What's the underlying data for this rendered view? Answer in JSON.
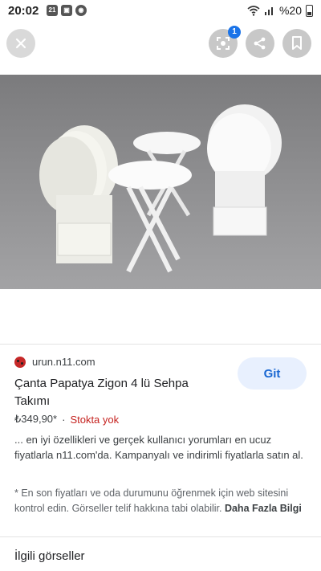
{
  "status_bar": {
    "time": "20:02",
    "battery": "%20",
    "notif_icons": [
      "21",
      "▣",
      "◉"
    ]
  },
  "toolbar": {
    "lens_badge": "1"
  },
  "result": {
    "source": "urun.n11.com",
    "title": "Çanta Papatya Zigon 4 lü Sehpa Takımı",
    "price": "₺349,90*",
    "separator": "·",
    "stock": "Stokta yok",
    "go_label": "Git",
    "description": "... en iyi özellikleri ve gerçek kullanıcı yorumları en ucuz fiyatlarla n11.com'da. Kampanyalı ve indirimli fiyatlarla satın al.",
    "note": "* En son fiyatları ve oda durumunu öğrenmek için web sitesini kontrol edin. Görseller telif hakkına tabi olabilir.",
    "more_link": "Daha Fazla Bilgi"
  },
  "related": {
    "heading": "İlgili görseller"
  },
  "colors": {
    "accent": "#1a73e8",
    "go_bg": "#e8f0fe",
    "stock": "#c5221f",
    "image_bg": "#8e8e90"
  },
  "icons": [
    "close-icon",
    "lens-icon",
    "share-icon",
    "bookmark-icon",
    "wifi-icon",
    "signal-icon",
    "battery-icon",
    "whatsapp-icon"
  ]
}
